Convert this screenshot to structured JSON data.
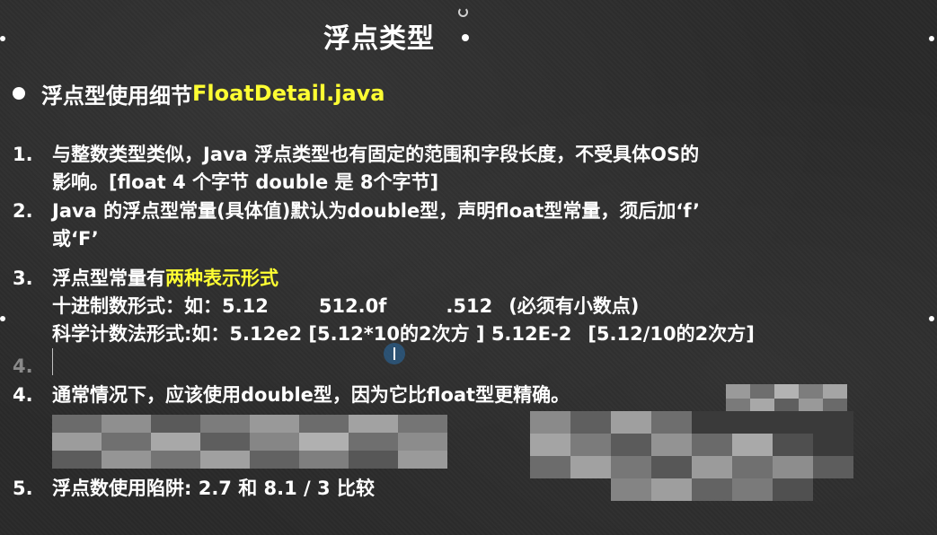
{
  "slide": {
    "title": "浮点类型",
    "heading": {
      "prefix": "浮点型使用细节 ",
      "filename": "FloatDetail.java"
    },
    "items": [
      {
        "num": "1.",
        "line1": "与整数类型类似，Java 浮点类型也有固定的范围和字段长度，不受具体OS的",
        "line2": "影响。[float 4 个字节 double 是 8个字节]"
      },
      {
        "num": "2.",
        "line1": "Java 的浮点型常量(具体值)默认为double型，声明float型常量，须后加‘f’",
        "line2": "或‘F’"
      },
      {
        "num": "3.",
        "line1_prefix": "浮点型常量有",
        "line1_highlight": "两种表示形式",
        "decimal_label": "十进制数形式：如：5.12",
        "decimal_ex2": "512.0f",
        "decimal_ex3": ".512",
        "decimal_note": "(必须有小数点)",
        "sci_label": "科学计数法形式:如：5.12e2 [5.12*10的2次方 ] 5.12E-2",
        "sci_note": "[5.12/10的2次方]"
      },
      {
        "num": "4."
      },
      {
        "num": "4.",
        "line1": "通常情况下，应该使用double型，因为它比float型更精确。"
      },
      {
        "num": "5.",
        "line1": "浮点数使用陷阱: 2.7 和 8.1 / 3  比较"
      }
    ],
    "colors": {
      "background": "#2a2a2a",
      "text": "#ffffff",
      "highlight": "#ffff33"
    }
  }
}
